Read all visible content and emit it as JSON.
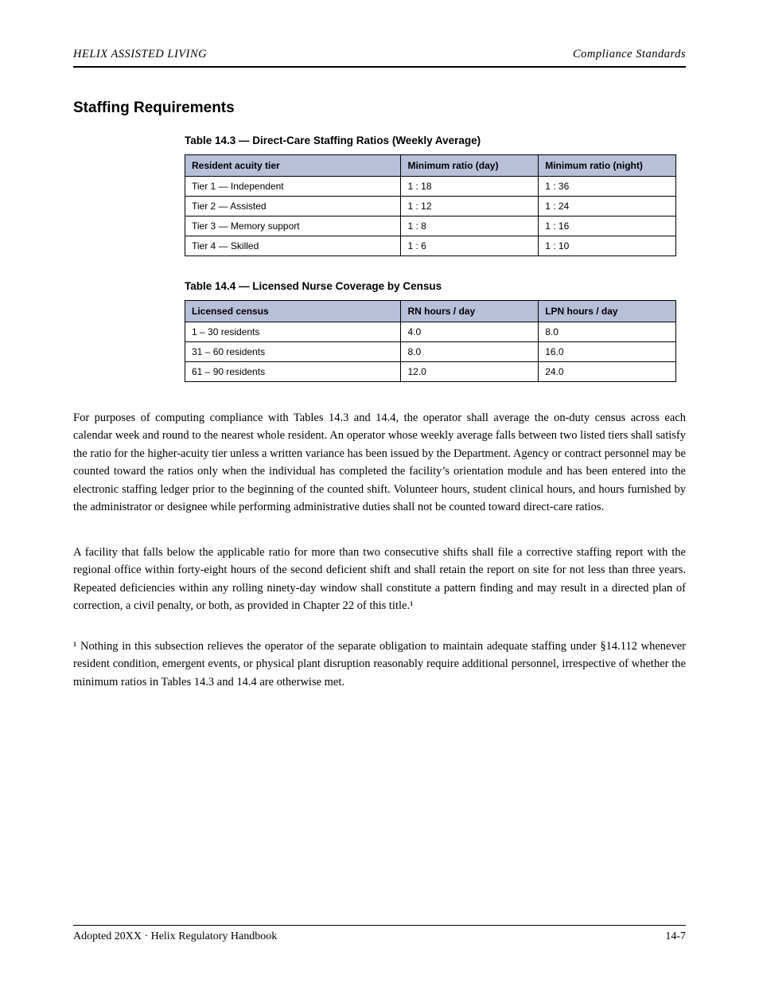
{
  "header": {
    "left": "HELIX ASSISTED LIVING",
    "right": "Compliance Standards"
  },
  "section_title": "Staffing Requirements",
  "table1": {
    "caption": "Table 14.3 — Direct-Care Staffing Ratios (Weekly Average)",
    "headers": [
      "Resident acuity tier",
      "Minimum ratio (day)",
      "Minimum ratio (night)"
    ],
    "rows": [
      [
        "Tier 1 — Independent",
        "1 : 18",
        "1 : 36"
      ],
      [
        "Tier 2 — Assisted",
        "1 : 12",
        "1 : 24"
      ],
      [
        "Tier 3 — Memory support",
        "1 : 8",
        "1 : 16"
      ],
      [
        "Tier 4 — Skilled",
        "1 : 6",
        "1 : 10"
      ]
    ]
  },
  "table2": {
    "caption": "Table 14.4 — Licensed Nurse Coverage by Census",
    "headers": [
      "Licensed census",
      "RN hours / day",
      "LPN hours / day"
    ],
    "rows": [
      [
        "1 – 30 residents",
        "4.0",
        "8.0"
      ],
      [
        "31 – 60 residents",
        "8.0",
        "16.0"
      ],
      [
        "61 – 90 residents",
        "12.0",
        "24.0"
      ]
    ]
  },
  "paragraph1": "For purposes of computing compliance with Tables 14.3 and 14.4, the operator shall average the on-duty census across each calendar week and round to the nearest whole resident. An operator whose weekly average falls between two listed tiers shall satisfy the ratio for the higher-acuity tier unless a written variance has been issued by the Department. Agency or contract personnel may be counted toward the ratios only when the individual has completed the facility’s orientation module and has been entered into the electronic staffing ledger prior to the beginning of the counted shift. Volunteer hours, student clinical hours, and hours furnished by the administrator or designee while performing administrative duties shall not be counted toward direct-care ratios.",
  "paragraph2": "A facility that falls below the applicable ratio for more than two consecutive shifts shall file a corrective staffing report with the regional office within forty-eight hours of the second deficient shift and shall retain the report on site for not less than three years. Repeated deficiencies within any rolling ninety-day window shall constitute a pattern finding and may result in a directed plan of correction, a civil penalty, or both, as provided in Chapter 22 of this title.¹",
  "footnote": "¹ Nothing in this subsection relieves the operator of the separate obligation to maintain adequate staffing under §14.112 whenever resident condition, emergent events, or physical plant disruption reasonably require additional personnel, irrespective of whether the minimum ratios in Tables 14.3 and 14.4 are otherwise met.",
  "footer": {
    "left": "Adopted 20XX · Helix Regulatory Handbook",
    "right": "14-7"
  }
}
